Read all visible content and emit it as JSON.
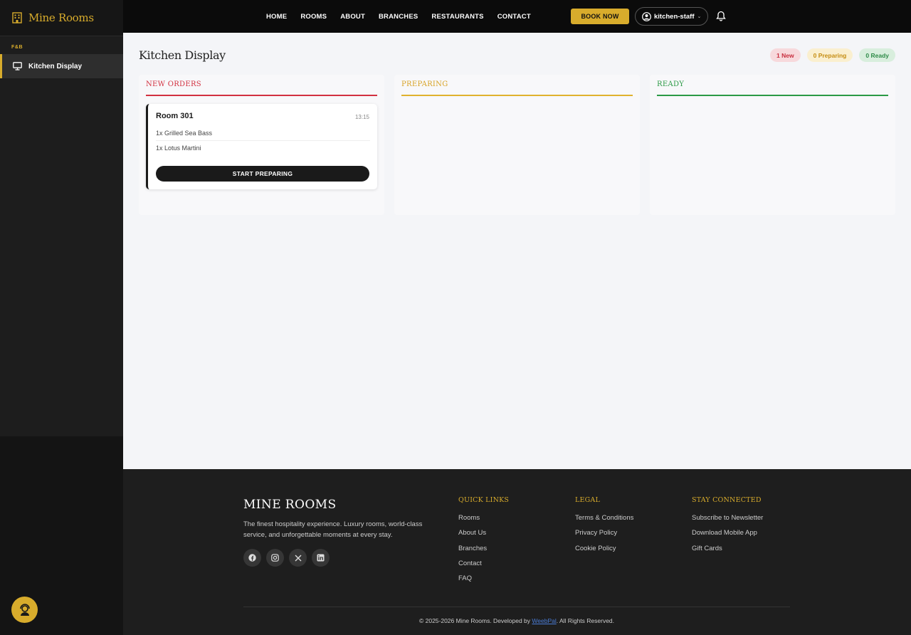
{
  "app": {
    "name": "Mine Rooms"
  },
  "sidebar": {
    "section": "F&B",
    "items": [
      {
        "label": "Kitchen Display",
        "icon": "monitor-icon",
        "active": true
      }
    ]
  },
  "nav": {
    "links": [
      "HOME",
      "ROOMS",
      "ABOUT",
      "BRANCHES",
      "RESTAURANTS",
      "CONTACT"
    ],
    "book_label": "BOOK NOW",
    "user_label": "kitchen-staff"
  },
  "page": {
    "title": "Kitchen Display",
    "badges": {
      "new": "1 New",
      "preparing": "0 Preparing",
      "ready": "0 Ready"
    }
  },
  "columns": {
    "new": {
      "title": "NEW ORDERS"
    },
    "preparing": {
      "title": "PREPARING"
    },
    "ready": {
      "title": "READY"
    }
  },
  "orders": [
    {
      "room": "Room 301",
      "time": "13:15",
      "items": [
        "1x Grilled Sea Bass",
        "1x Lotus Martini"
      ],
      "action": "START PREPARING"
    }
  ],
  "footer": {
    "brand": "MINE ROOMS",
    "description": "The finest hospitality experience. Luxury rooms, world-class service, and unforgettable moments at every stay.",
    "quick_links": {
      "title": "QUICK LINKS",
      "items": [
        "Rooms",
        "About Us",
        "Branches",
        "Contact",
        "FAQ"
      ]
    },
    "legal": {
      "title": "LEGAL",
      "items": [
        "Terms & Conditions",
        "Privacy Policy",
        "Cookie Policy"
      ]
    },
    "connected": {
      "title": "STAY CONNECTED",
      "items": [
        "Subscribe to Newsletter",
        "Download Mobile App",
        "Gift Cards"
      ]
    },
    "copyright_prefix": "© 2025-2026 Mine Rooms. Developed by ",
    "developer": "WeebPal",
    "copyright_suffix": ". All Rights Reserved."
  },
  "colors": {
    "accent": "#d8ac2c",
    "new": "#d23140",
    "preparing": "#e0b22d",
    "ready": "#2b9a45"
  }
}
